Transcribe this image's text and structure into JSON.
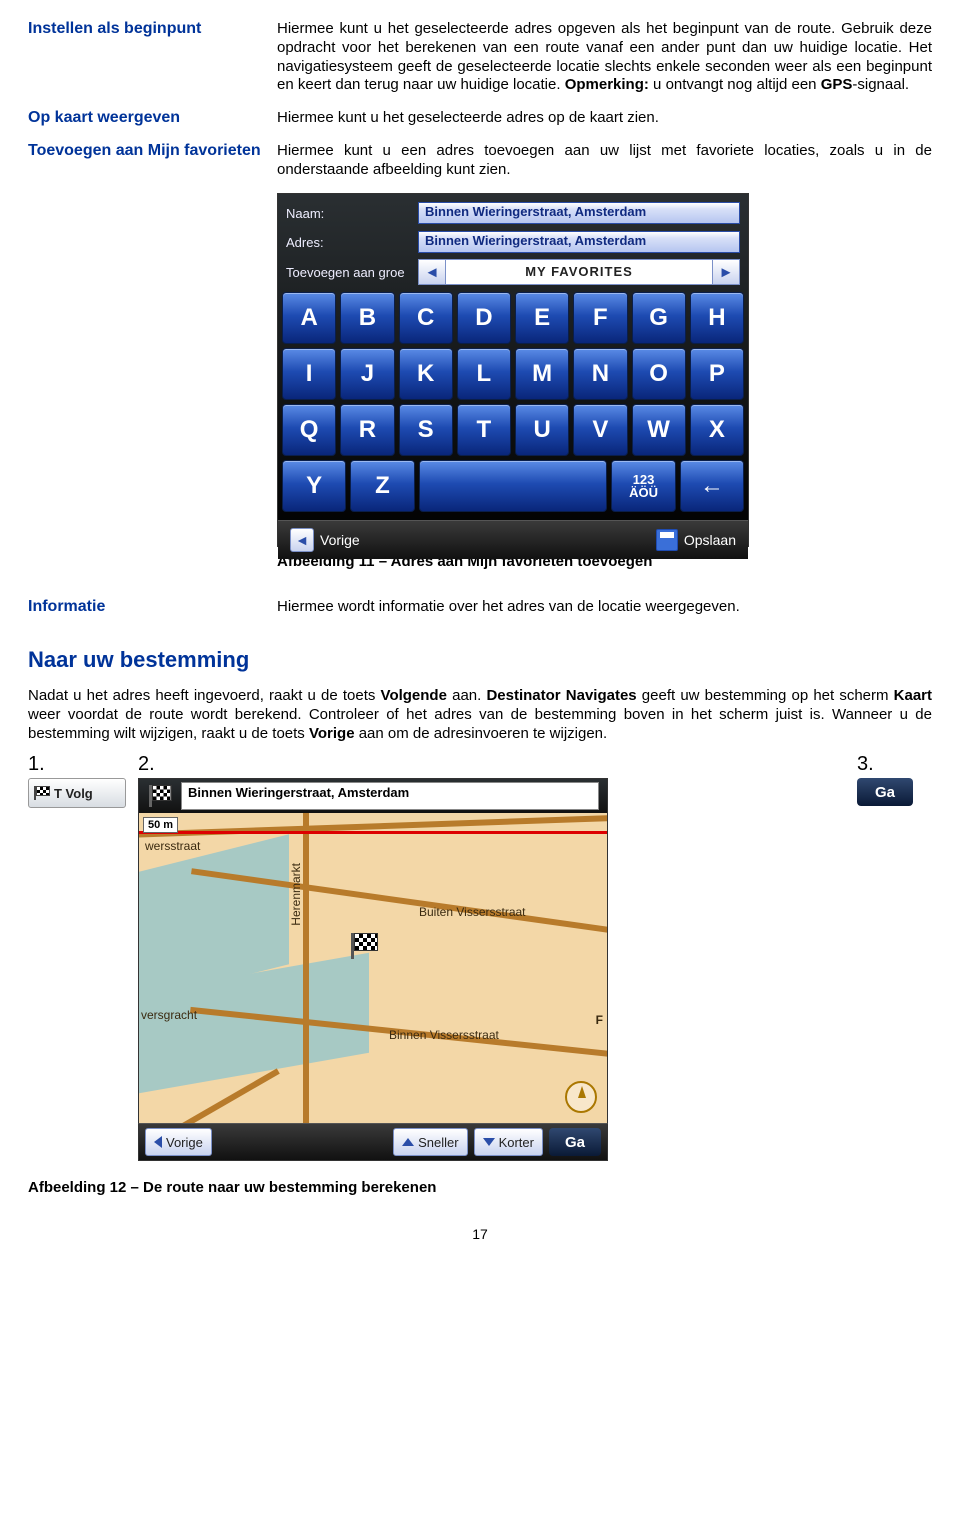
{
  "sections": {
    "s1_term": "Instellen als beginpunt",
    "s1_text_a": "Hiermee kunt u het geselecteerde adres opgeven als het beginpunt van de route. Gebruik deze opdracht voor het berekenen van een route vanaf een ander punt dan uw huidige locatie. Het navigatiesysteem geeft de geselecteerde locatie slechts enkele seconden weer als een beginpunt en keert dan terug naar uw huidige locatie. ",
    "s1_text_b_bold": "Opmerking:",
    "s1_text_c": " u ontvangt nog altijd een ",
    "s1_text_d_bold": "GPS",
    "s1_text_e": "-signaal.",
    "s2_term": "Op kaart weergeven",
    "s2_text": "Hiermee kunt u het geselecteerde adres op de kaart zien.",
    "s3_term": "Toevoegen aan Mijn favorieten",
    "s3_text": "Hiermee kunt u een adres toevoegen aan uw lijst met favoriete locaties, zoals u in de onderstaande afbeelding kunt zien."
  },
  "fav": {
    "naam_label": "Naam:",
    "naam_value": "Binnen Wieringerstraat, Amsterdam",
    "adres_label": "Adres:",
    "adres_value": "Binnen Wieringerstraat, Amsterdam",
    "group_label": "Toevoegen aan groe",
    "group_value": "MY FAVORITES",
    "keys_row1": [
      "A",
      "B",
      "C",
      "D",
      "E",
      "F",
      "G",
      "H"
    ],
    "keys_row2": [
      "I",
      "J",
      "K",
      "L",
      "M",
      "N",
      "O",
      "P"
    ],
    "keys_row3": [
      "Q",
      "R",
      "S",
      "T",
      "U",
      "V",
      "W",
      "X"
    ],
    "keys_row4_yz": [
      "Y",
      "Z"
    ],
    "key_space": "",
    "key_num": "123\nÄÖÜ",
    "key_back": "←",
    "btn_prev": "Vorige",
    "btn_save": "Opslaan"
  },
  "caption1": "Afbeelding 11 – Adres aan Mijn favorieten toevoegen",
  "info": {
    "term": "Informatie",
    "text": "Hiermee wordt informatie over het adres van de locatie weergegeven."
  },
  "heading": "Naar uw bestemming",
  "para": {
    "a": "Nadat u het adres heeft ingevoerd, raakt u de toets ",
    "b_bold": "Volgende",
    "c": " aan. ",
    "d_bold": "Destinator Navigates",
    "e": " geeft uw bestemming op het scherm ",
    "f_bold": "Kaart",
    "g": " weer voordat de route wordt berekend. Controleer of het adres van de bestemming boven in het scherm juist is. Wanneer u de bestemming wilt wijzigen, raakt u de toets ",
    "h_bold": "Vorige",
    "i": " aan om de adresinvoeren te wijzigen."
  },
  "steps": {
    "n1": "1.",
    "n2": "2.",
    "n3": "3."
  },
  "tvolg": "T Volg",
  "ga": "Ga",
  "map": {
    "dest": "Binnen Wieringerstraat, Amsterdam",
    "scale": "50 m",
    "labels": {
      "wers": "wersstraat",
      "heren": "Herenmarkt",
      "buiten": "Buiten Vissersstraat",
      "binnen": "Binnen Vissersstraat",
      "versgracht": "versgracht",
      "f": "F"
    },
    "btn_prev": "Vorige",
    "btn_faster": "Sneller",
    "btn_shorter": "Korter",
    "btn_go": "Ga"
  },
  "caption2": "Afbeelding 12 – De route naar uw bestemming berekenen",
  "page": "17"
}
